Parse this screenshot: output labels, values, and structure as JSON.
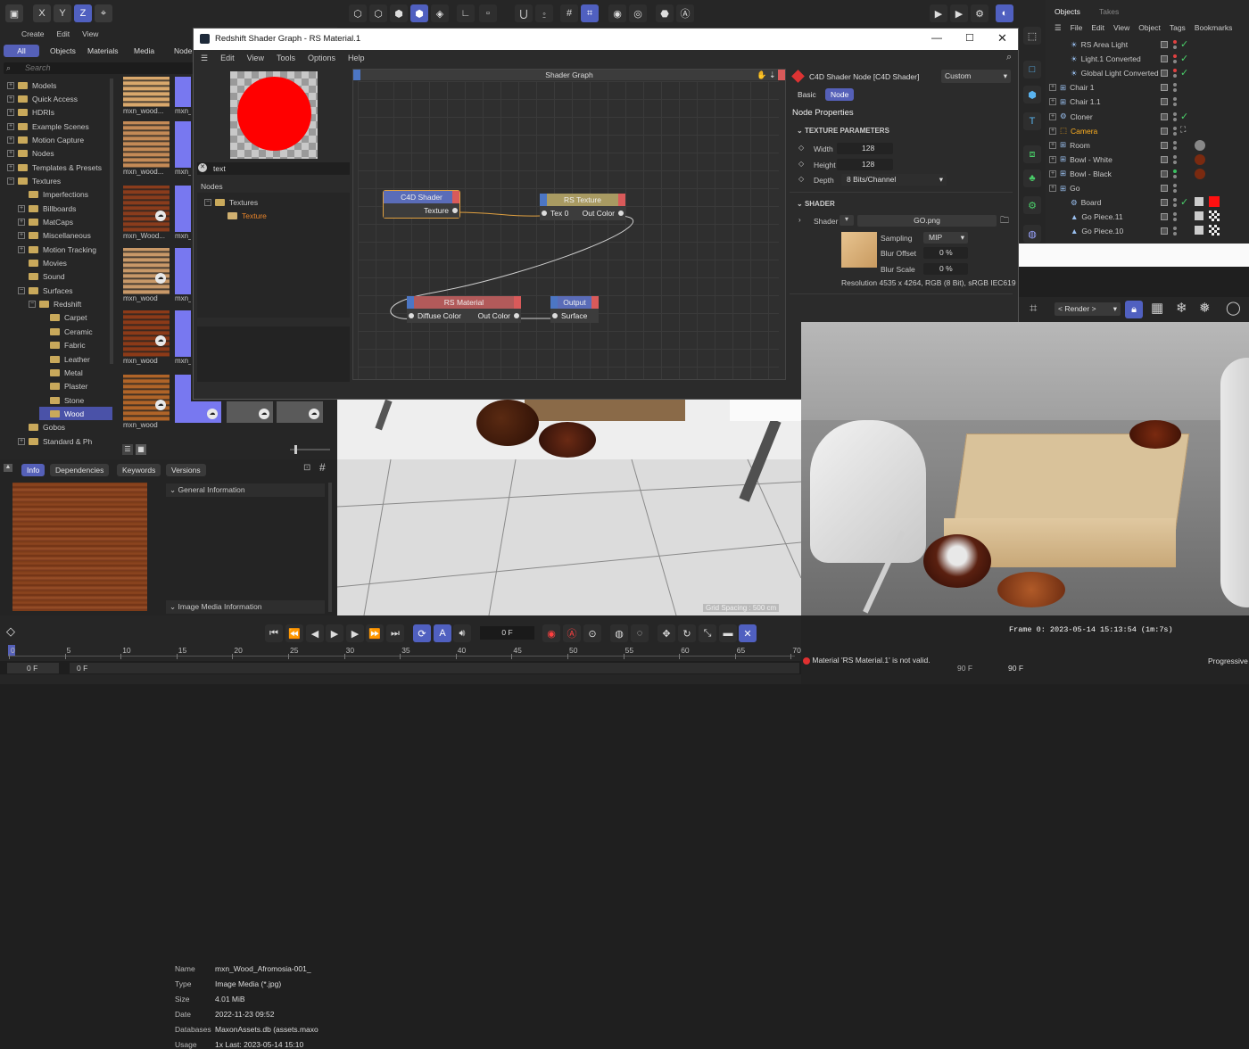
{
  "top_toolbar": {
    "axis_x": "X",
    "axis_y": "Y",
    "axis_z": "Z"
  },
  "asset_browser": {
    "menu": [
      "Create",
      "Edit",
      "View"
    ],
    "tabs": [
      "All",
      "Objects",
      "Materials",
      "Media",
      "Node"
    ],
    "search_placeholder": "Search",
    "tree": [
      {
        "label": "Models",
        "level": 0,
        "pm": "+"
      },
      {
        "label": "Quick Access",
        "level": 0,
        "pm": "+"
      },
      {
        "label": "HDRIs",
        "level": 0,
        "pm": "+"
      },
      {
        "label": "Example Scenes",
        "level": 0,
        "pm": "+"
      },
      {
        "label": "Motion Capture",
        "level": 0,
        "pm": "+"
      },
      {
        "label": "Nodes",
        "level": 0,
        "pm": "+"
      },
      {
        "label": "Templates & Presets",
        "level": 0,
        "pm": "+"
      },
      {
        "label": "Textures",
        "level": 0,
        "pm": "−"
      },
      {
        "label": "Imperfections",
        "level": 1,
        "pm": ""
      },
      {
        "label": "Billboards",
        "level": 1,
        "pm": "+"
      },
      {
        "label": "MatCaps",
        "level": 1,
        "pm": "+"
      },
      {
        "label": "Miscellaneous",
        "level": 1,
        "pm": "+"
      },
      {
        "label": "Motion Tracking",
        "level": 1,
        "pm": "+"
      },
      {
        "label": "Movies",
        "level": 1,
        "pm": ""
      },
      {
        "label": "Sound",
        "level": 1,
        "pm": ""
      },
      {
        "label": "Surfaces",
        "level": 1,
        "pm": "−"
      },
      {
        "label": "Redshift",
        "level": 2,
        "pm": "−"
      },
      {
        "label": "Carpet",
        "level": 3,
        "pm": ""
      },
      {
        "label": "Ceramic",
        "level": 3,
        "pm": ""
      },
      {
        "label": "Fabric",
        "level": 3,
        "pm": ""
      },
      {
        "label": "Leather",
        "level": 3,
        "pm": ""
      },
      {
        "label": "Metal",
        "level": 3,
        "pm": ""
      },
      {
        "label": "Plaster",
        "level": 3,
        "pm": ""
      },
      {
        "label": "Stone",
        "level": 3,
        "pm": ""
      },
      {
        "label": "Wood",
        "level": 3,
        "pm": "",
        "selected": true
      },
      {
        "label": "Gobos",
        "level": 1,
        "pm": ""
      },
      {
        "label": "Standard & Ph",
        "level": 1,
        "pm": "+"
      }
    ],
    "thumb_labels": [
      "mxn_wood...",
      "mxn_woo",
      "mxn_wood...",
      "mxn_Wood...",
      "mxn_Wood...",
      "mxn_Wood...",
      "mxn_wood",
      "mxn_wood",
      "mxn_wood",
      "mxn_wood",
      "mxn_wood"
    ]
  },
  "info_panel": {
    "tabs": [
      "Info",
      "Dependencies",
      "Keywords",
      "Versions"
    ],
    "section_general": "General Information",
    "rows": [
      {
        "k": "Name",
        "v": "mxn_Wood_Afromosia-001_"
      },
      {
        "k": "Type",
        "v": "Image Media (*.jpg)"
      },
      {
        "k": "Size",
        "v": "4.01 MiB"
      },
      {
        "k": "Date",
        "v": "2022-11-23 09:52"
      },
      {
        "k": "Databases",
        "v": "MaxonAssets.db (assets.maxo"
      },
      {
        "k": "Usage",
        "v": "1x Last: 2023-05-14 15:10"
      }
    ],
    "section_image": "Image Media Information"
  },
  "shader_window": {
    "title": "Redshift Shader Graph - RS Material.1",
    "menu": [
      "Edit",
      "View",
      "Tools",
      "Options",
      "Help"
    ],
    "search_value": "text",
    "nodes_header": "Nodes",
    "nodes_tree": [
      "Textures",
      "Texture"
    ],
    "graph_title": "Shader Graph",
    "nodes": {
      "c4d": {
        "title": "C4D Shader",
        "port": "Texture"
      },
      "rstex": {
        "title": "RS Texture",
        "in": "Tex 0",
        "out": "Out Color"
      },
      "rsmat": {
        "title": "RS Material",
        "in": "Diffuse Color",
        "out": "Out Color"
      },
      "output": {
        "title": "Output",
        "in": "Surface"
      }
    },
    "props": {
      "node_title": "C4D Shader Node [C4D Shader]",
      "preset": "Custom",
      "tabs": [
        "Basic",
        "Node"
      ],
      "section": "Node Properties",
      "tex_params": "TEXTURE PARAMETERS",
      "width_label": "Width",
      "width": "128",
      "height_label": "Height",
      "height": "128",
      "depth_label": "Depth",
      "depth": "8 Bits/Channel",
      "shader_section": "SHADER",
      "shader_label": "Shader",
      "shader_file": "GO.png",
      "sampling_label": "Sampling",
      "sampling": "MIP",
      "blur_offset_label": "Blur Offset",
      "blur_offset": "0 %",
      "blur_scale_label": "Blur Scale",
      "blur_scale": "0 %",
      "resolution": "Resolution 4535 x 4264, RGB (8 Bit), sRGB IEC619"
    }
  },
  "objects_panel": {
    "tabs": [
      "Objects",
      "Takes"
    ],
    "menu": [
      "File",
      "Edit",
      "View",
      "Object",
      "Tags",
      "Bookmarks"
    ],
    "items": [
      {
        "label": "RS Area Light",
        "indent": 1
      },
      {
        "label": "Light.1 Converted",
        "indent": 1
      },
      {
        "label": "Global Light Converted",
        "indent": 1
      },
      {
        "label": "Chair 1",
        "indent": 0
      },
      {
        "label": "Chair 1.1",
        "indent": 0
      },
      {
        "label": "Cloner",
        "indent": 0
      },
      {
        "label": "Camera",
        "indent": 0,
        "highlight": true
      },
      {
        "label": "Room",
        "indent": 0
      },
      {
        "label": "Bowl - White",
        "indent": 0
      },
      {
        "label": "Bowl - Black",
        "indent": 0
      },
      {
        "label": "Go",
        "indent": 0
      },
      {
        "label": "Board",
        "indent": 1
      },
      {
        "label": "Go Piece.11",
        "indent": 1
      },
      {
        "label": "Go Piece.10",
        "indent": 1
      }
    ]
  },
  "viewport": {
    "grid_spacing": "Grid Spacing : 500 cm"
  },
  "render_view": {
    "render_dropdown": "< Render >",
    "frame_info": "Frame 0: 2023-05-14 15:13:54 (1m:7s)",
    "status": "Material 'RS Material.1' is not valid.",
    "progress": "Progressive",
    "end_frame": "90 F"
  },
  "timeline": {
    "current_frame": "0 F",
    "ticks": [
      "0",
      "5",
      "10",
      "15",
      "20",
      "25",
      "30",
      "35",
      "40",
      "45",
      "50",
      "55",
      "60",
      "65",
      "70"
    ],
    "start": "0 F",
    "start2": "0 F",
    "end": "90 F",
    "end2": "90 F"
  }
}
